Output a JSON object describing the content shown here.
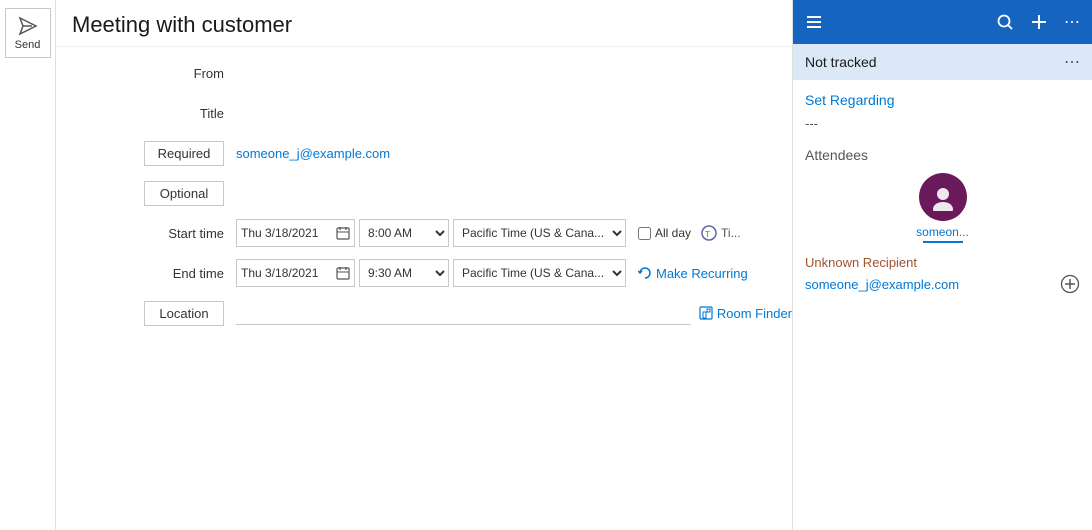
{
  "send_panel": {
    "send_label": "Send"
  },
  "form": {
    "from_label": "From",
    "title_label": "Title",
    "meeting_title": "Meeting with customer",
    "required_label": "Required",
    "optional_label": "Optional",
    "required_email": "someone_j@example.com",
    "start_time_label": "Start time",
    "end_time_label": "End time",
    "start_date": "Thu 3/18/2021",
    "end_date": "Thu 3/18/2021",
    "start_time": "8:00 AM",
    "end_time": "9:30 AM",
    "timezone": "Pacific Time (US & Cana...",
    "allday_label": "All day",
    "teams_label": "Ti...",
    "recurring_label": "Make Recurring",
    "location_label": "Location",
    "location_placeholder": "",
    "room_finder_label": "Room Finder"
  },
  "right_panel": {
    "header_icons": {
      "hamburger": "☰",
      "search": "⌕",
      "add": "+",
      "more": "⋯"
    },
    "not_tracked_label": "Not tracked",
    "more_dots": "⋯",
    "set_regarding_label": "Set Regarding",
    "regarding_value": "---",
    "attendees_label": "Attendees",
    "attendee": {
      "icon": "👤",
      "name": "someon..."
    },
    "unknown_recipient_label": "Unknown Recipient",
    "unknown_email": "someone_j@example.com",
    "add_icon": "⊕"
  }
}
